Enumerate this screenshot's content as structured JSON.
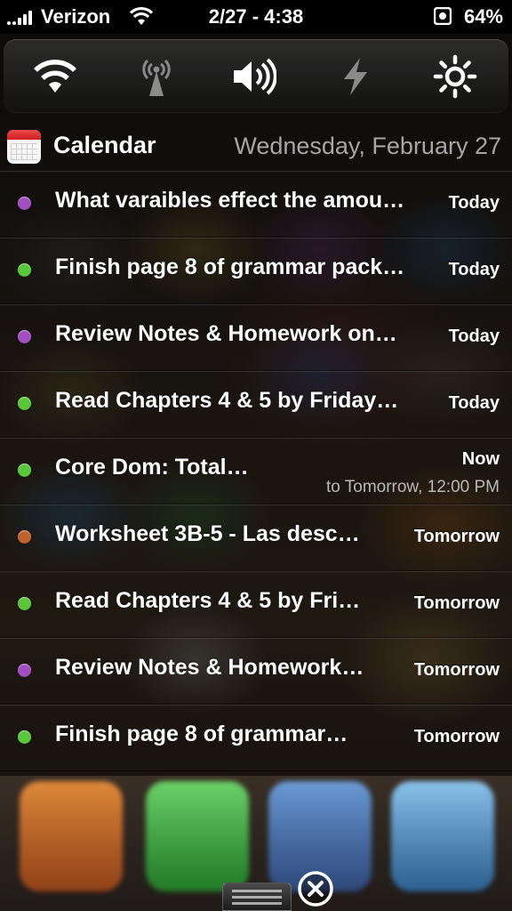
{
  "status_bar": {
    "carrier": "Verizon",
    "time": "2/27 - 4:38",
    "battery": "64%",
    "signal_icon": "signal-bars-icon",
    "wifi_icon": "wifi-icon",
    "lock_icon": "orientation-lock-icon"
  },
  "toggles": [
    {
      "name": "wifi-toggle",
      "icon": "wifi-icon",
      "active": true
    },
    {
      "name": "data-toggle",
      "icon": "cellular-tower-icon",
      "active": false
    },
    {
      "name": "sound-toggle",
      "icon": "speaker-icon",
      "active": true
    },
    {
      "name": "power-toggle",
      "icon": "lightning-icon",
      "active": false
    },
    {
      "name": "brightness-toggle",
      "icon": "sun-icon",
      "active": true
    }
  ],
  "calendar": {
    "title": "Calendar",
    "date": "Wednesday, February 27",
    "events": [
      {
        "title": "What varaibles effect the amou…",
        "when": "Today",
        "color": "#a04fc0"
      },
      {
        "title": "Finish page 8 of grammar pack…",
        "when": "Today",
        "color": "#5ac63a"
      },
      {
        "title": "Review Notes & Homework on…",
        "when": "Today",
        "color": "#a04fc0"
      },
      {
        "title": "Read Chapters 4 & 5 by Friday…",
        "when": "Today",
        "color": "#5ac63a"
      },
      {
        "title": "Core Dom: Total…",
        "when": "Now",
        "when2": "to Tomorrow, 12:00 PM",
        "color": "#5ac63a"
      },
      {
        "title": "Worksheet 3B-5 - Las desc…",
        "when": "Tomorrow",
        "color": "#c0622e"
      },
      {
        "title": "Read Chapters 4 & 5 by Fri…",
        "when": "Tomorrow",
        "color": "#5ac63a"
      },
      {
        "title": "Review Notes & Homework…",
        "when": "Tomorrow",
        "color": "#a04fc0"
      },
      {
        "title": "Finish page 8 of grammar…",
        "when": "Tomorrow",
        "color": "#5ac63a"
      }
    ]
  },
  "bottom": {
    "grabber_icon": "grabber-handle-icon",
    "close_icon": "close-circle-icon"
  }
}
